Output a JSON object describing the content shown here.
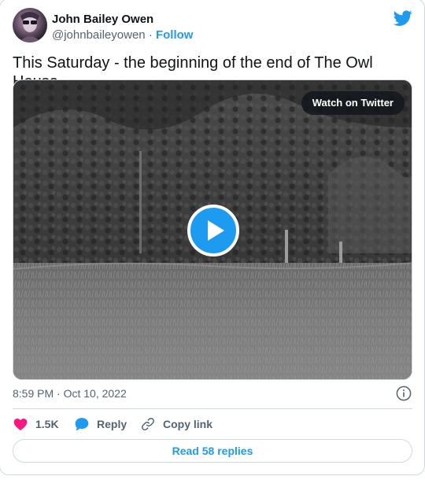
{
  "author": {
    "display_name": "John Bailey Owen",
    "handle": "@johnbaileyowen",
    "separator": "·",
    "follow_label": "Follow"
  },
  "tweet": {
    "text": "This Saturday - the beginning of the end of The Owl House."
  },
  "media": {
    "watch_label": "Watch on Twitter"
  },
  "meta": {
    "timestamp": "8:59 PM · Oct 10, 2022"
  },
  "actions": {
    "like_count": "1.5K",
    "reply_label": "Reply",
    "copy_link_label": "Copy link"
  },
  "read_replies_label": "Read 58 replies",
  "colors": {
    "accent": "#1d9bf0",
    "like": "#f91880",
    "text_primary": "#0f1419",
    "text_secondary": "#536471",
    "border": "#cfd9de"
  },
  "icons": [
    "twitter-bird-icon",
    "play-icon",
    "info-icon",
    "heart-icon",
    "reply-bubble-icon",
    "link-icon"
  ]
}
